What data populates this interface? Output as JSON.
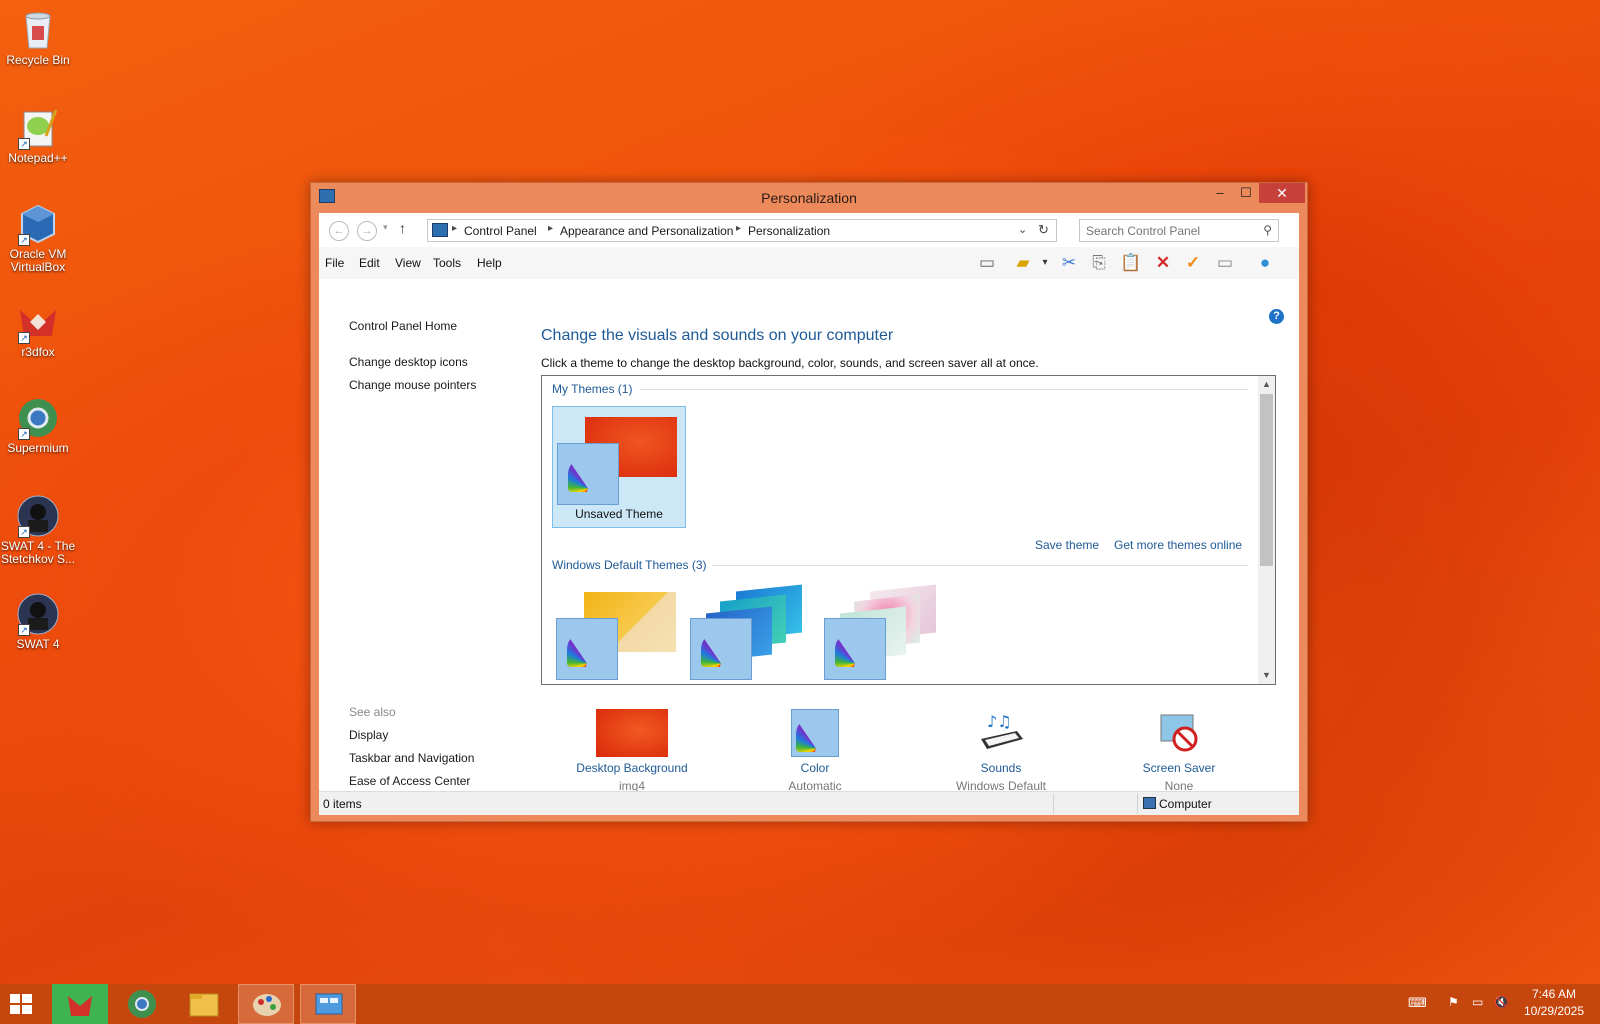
{
  "desktop": {
    "icons": [
      {
        "label": "Recycle Bin"
      },
      {
        "label": "Notepad++"
      },
      {
        "label": "Oracle VM VirtualBox"
      },
      {
        "label": "r3dfox"
      },
      {
        "label": "Supermium"
      },
      {
        "label": "SWAT 4 - The Stetchkov S..."
      },
      {
        "label": "SWAT 4"
      }
    ]
  },
  "window": {
    "title": "Personalization",
    "controls": {
      "minimize": "–",
      "maximize": "☐",
      "close": "✕"
    },
    "breadcrumb": [
      "Control Panel",
      "Appearance and Personalization",
      "Personalization"
    ],
    "search": {
      "placeholder": "Search Control Panel"
    },
    "menu": [
      "File",
      "Edit",
      "View",
      "Tools",
      "Help"
    ],
    "sidebar": {
      "home": "Control Panel Home",
      "links": [
        "Change desktop icons",
        "Change mouse pointers"
      ],
      "see_also_label": "See also",
      "see_also": [
        "Display",
        "Taskbar and Navigation",
        "Ease of Access Center"
      ]
    },
    "main": {
      "heading": "Change the visuals and sounds on your computer",
      "subheading": "Click a theme to change the desktop background, color, sounds, and screen saver all at once.",
      "my_themes_label": "My Themes (1)",
      "unsaved_theme": "Unsaved Theme",
      "save_theme": "Save theme",
      "get_more": "Get more themes online",
      "default_themes_label": "Windows Default Themes (3)"
    },
    "settings": [
      {
        "label": "Desktop Background",
        "value": "img4"
      },
      {
        "label": "Color",
        "value": "Automatic"
      },
      {
        "label": "Sounds",
        "value": "Windows Default"
      },
      {
        "label": "Screen Saver",
        "value": "None"
      }
    ],
    "status": {
      "items": "0 items",
      "location": "Computer"
    }
  },
  "taskbar": {
    "clock_time": "7:46 AM",
    "clock_date": "10/29/2025"
  },
  "colors": {
    "accent": "#ed8a5c",
    "link": "#1e5a96",
    "close": "#c7413a",
    "taskbar": "#c6470e"
  }
}
